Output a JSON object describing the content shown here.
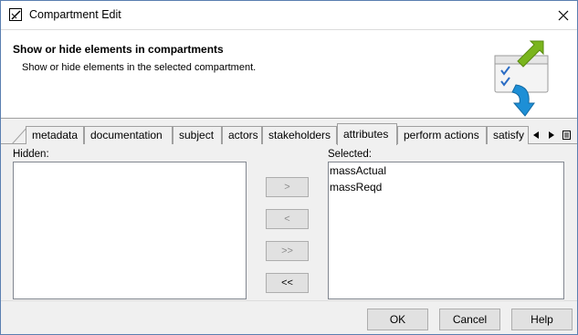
{
  "window": {
    "title": "Compartment Edit"
  },
  "header": {
    "title": "Show or hide elements in compartments",
    "description": "Show or hide elements in the selected compartment."
  },
  "tabs": [
    {
      "label": "metadata",
      "active": false
    },
    {
      "label": "documentation",
      "active": false
    },
    {
      "label": "subject",
      "active": false
    },
    {
      "label": "actors",
      "active": false
    },
    {
      "label": "stakeholders",
      "active": false
    },
    {
      "label": "attributes",
      "active": true
    },
    {
      "label": "perform actions",
      "active": false
    },
    {
      "label": "satisfy",
      "active": false
    }
  ],
  "hidden": {
    "label": "Hidden:",
    "items": []
  },
  "selected": {
    "label": "Selected:",
    "items": [
      "massActual",
      "massReqd"
    ]
  },
  "move_buttons": {
    "add": ">",
    "remove": "<",
    "add_all": ">>",
    "remove_all": "<<"
  },
  "footer": {
    "ok": "OK",
    "cancel": "Cancel",
    "help": "Help"
  },
  "colors": {
    "arrow_green": "#7ab51d",
    "arrow_blue": "#1d8fd6",
    "check_blue": "#2a6cc4"
  }
}
